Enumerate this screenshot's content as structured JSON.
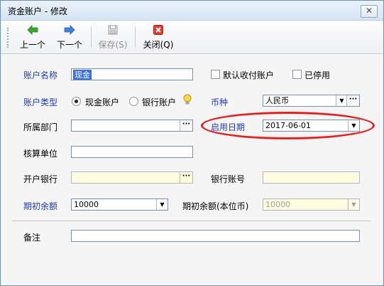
{
  "window": {
    "title": "资金账户 - 修改",
    "close_glyph": "✕"
  },
  "toolbar": {
    "prev_label": "上一个",
    "next_label": "下一个",
    "save_label": "保存(S)",
    "close_label": "关闭(Q)"
  },
  "form": {
    "account_name": {
      "label": "账户名称",
      "value": "现金"
    },
    "default_account": {
      "label": "默认收付账户",
      "checked": false
    },
    "disabled_flag": {
      "label": "已停用",
      "checked": false
    },
    "account_type": {
      "label": "账户类型",
      "option_cash": "现金账户",
      "option_bank": "银行账户",
      "selected": "现金账户"
    },
    "currency": {
      "label": "币种",
      "value": "人民币"
    },
    "department": {
      "label": "所属部门",
      "value": ""
    },
    "start_date": {
      "label": "启用日期",
      "value": "2017-06-01"
    },
    "accounting_unit": {
      "label": "核算单位",
      "value": ""
    },
    "bank": {
      "label": "开户银行",
      "value": ""
    },
    "bank_account_no": {
      "label": "银行账号",
      "value": ""
    },
    "opening_balance": {
      "label": "期初余额",
      "value": "10000"
    },
    "opening_balance_local": {
      "label": "期初余额(本位币)",
      "value": "10000"
    },
    "remark": {
      "label": "备注",
      "value": ""
    }
  },
  "icons": {
    "prev": "left-arrow-icon",
    "next": "right-arrow-icon",
    "save": "floppy-disk-icon",
    "close": "red-x-icon",
    "hint": "lightbulb-icon"
  },
  "colors": {
    "required_label": "#1c3bb5",
    "annotation": "#e32121",
    "readonly_field": "#fffde0"
  }
}
